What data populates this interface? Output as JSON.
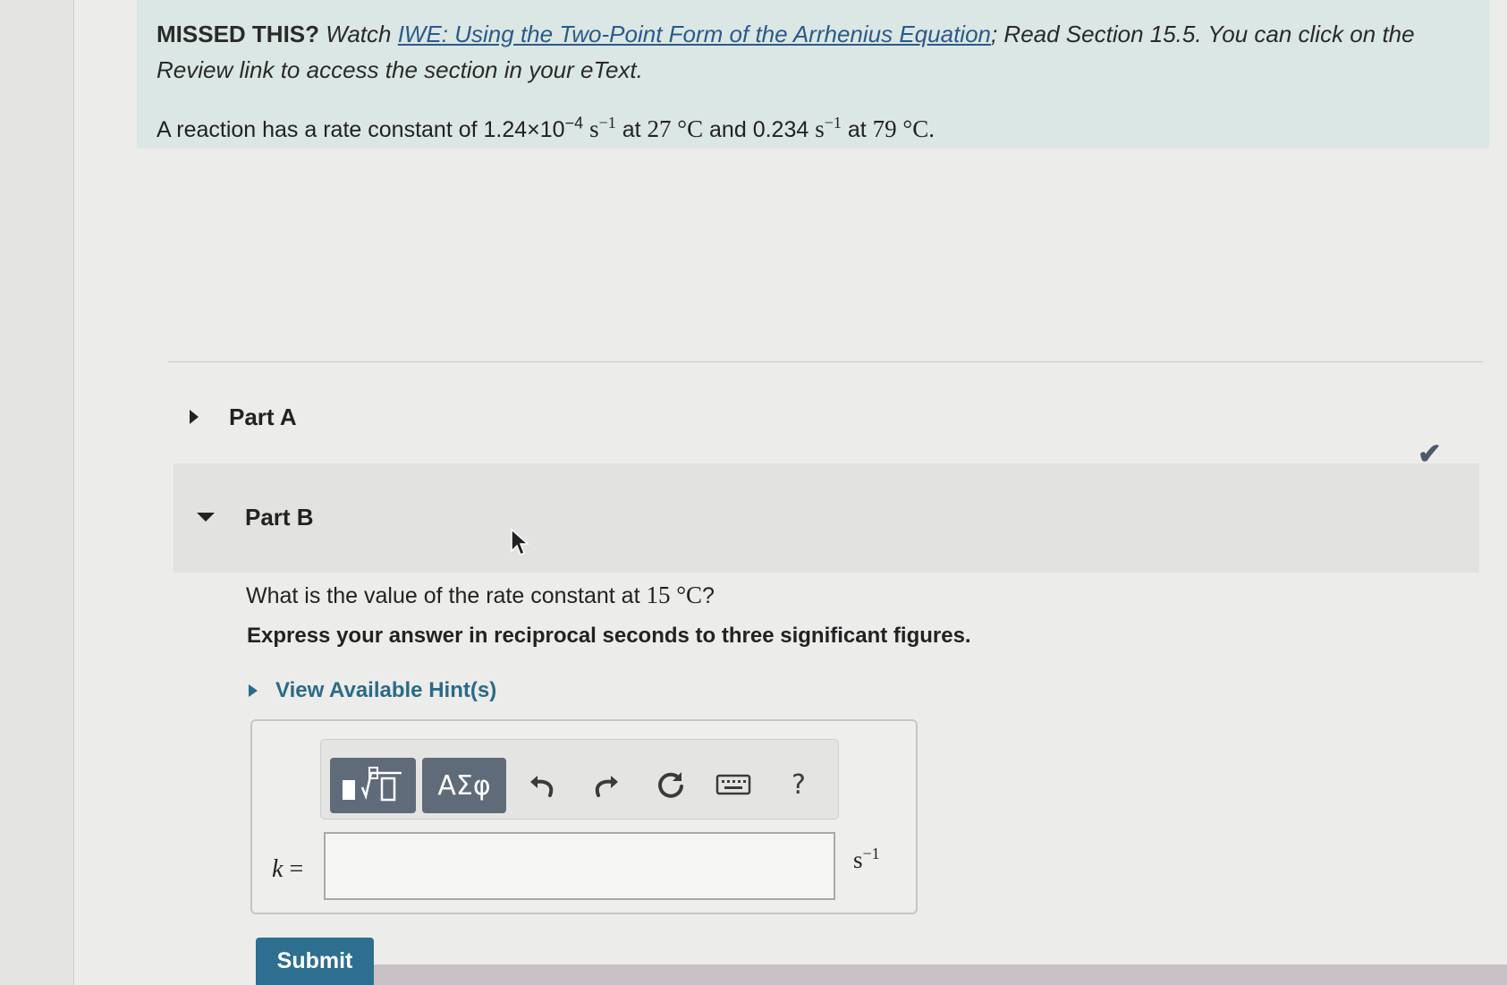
{
  "intro": {
    "missed_label": "MISSED THIS?",
    "watch_text": "Watch",
    "video_link": "IWE: Using the Two-Point Form of the Arrhenius Equation",
    "rest_text": "; Read Section 15.5. You can click on the Review link to access the section in your eText."
  },
  "statement": {
    "prefix": "A reaction has a rate constant of",
    "k1_mantissa": "1.24×10",
    "k1_exponent": "−4",
    "unit_s": "s",
    "unit_exp": "−1",
    "at1": "at",
    "t1": "27 °C",
    "and": "and",
    "k2": "0.234",
    "at2": "at",
    "t2": "79 °C",
    "period": "."
  },
  "parts": {
    "a_label": "Part A",
    "b_label": "Part B"
  },
  "part_b": {
    "question_prefix": "What is the value of the rate constant at",
    "question_temp": "15 °C",
    "question_suffix": "?",
    "instructions": "Express your answer in reciprocal seconds to three significant figures.",
    "hints_label": "View Available Hint(s)"
  },
  "toolbar": {
    "symbols_label": "ΑΣφ",
    "help_label": "?"
  },
  "answer": {
    "variable": "k",
    "equals": "=",
    "value": "",
    "unit_base": "s",
    "unit_exp": "−1"
  },
  "submit_label": "Submit"
}
